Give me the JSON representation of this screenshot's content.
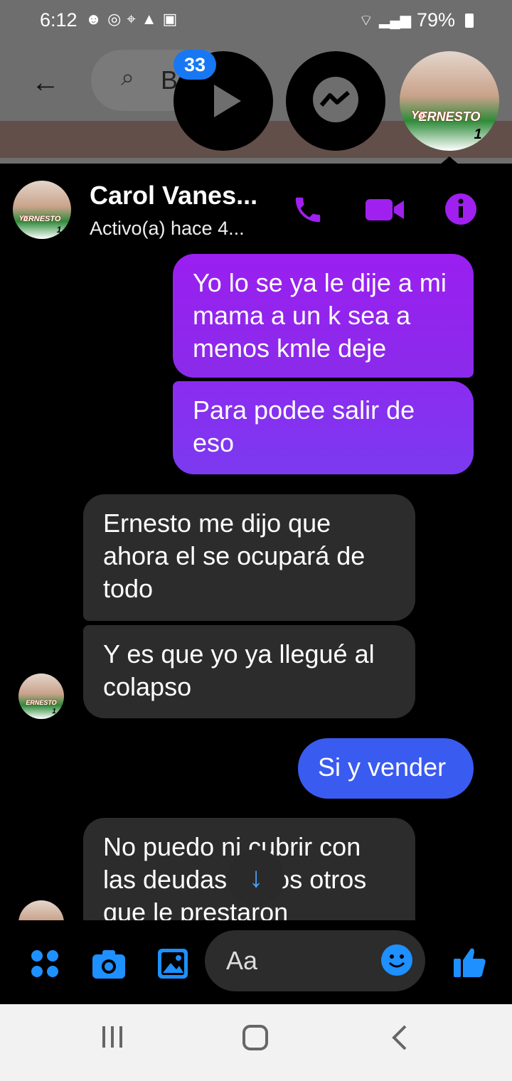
{
  "status_bar": {
    "time": "6:12",
    "battery": "79%"
  },
  "background": {
    "search_text": "B"
  },
  "chat_heads": {
    "badge_count": "33"
  },
  "avatar_text": "ERNESTO",
  "avatar_prefix": "Yo",
  "avatar_number": "1",
  "header": {
    "contact_name": "Carol Vanes...",
    "contact_status": "Activo(a) hace 4..."
  },
  "messages": [
    {
      "text": "Yo lo se ya le dije a mi mama a un k sea a menos kmle deje"
    },
    {
      "text": "Para podee salir de eso"
    },
    {
      "text": "Ernesto me dijo que ahora el se ocupará de todo"
    },
    {
      "text": "Y es que yo ya llegué al colapso"
    },
    {
      "text": "Si y vender"
    },
    {
      "text": "No puedo ni cubrir con las deudas de los otros que le prestaron"
    }
  ],
  "composer": {
    "placeholder": "Aa"
  },
  "icons": {
    "back": "arrow-left",
    "search": "magnifier",
    "phone": "phone",
    "video": "video-camera",
    "info": "info",
    "apps": "four-dots",
    "camera": "camera",
    "gallery": "image",
    "emoji": "smiley",
    "like": "thumbs-up",
    "scroll_down": "arrow-down",
    "nav_recents": "three-bars",
    "nav_home": "rounded-square",
    "nav_back": "chevron-left"
  },
  "colors": {
    "accent_purple": "#a020f0",
    "sent_blue": "#3a5bf0",
    "received_bg": "#2c2c2c",
    "icon_blue": "#1e90ff"
  }
}
